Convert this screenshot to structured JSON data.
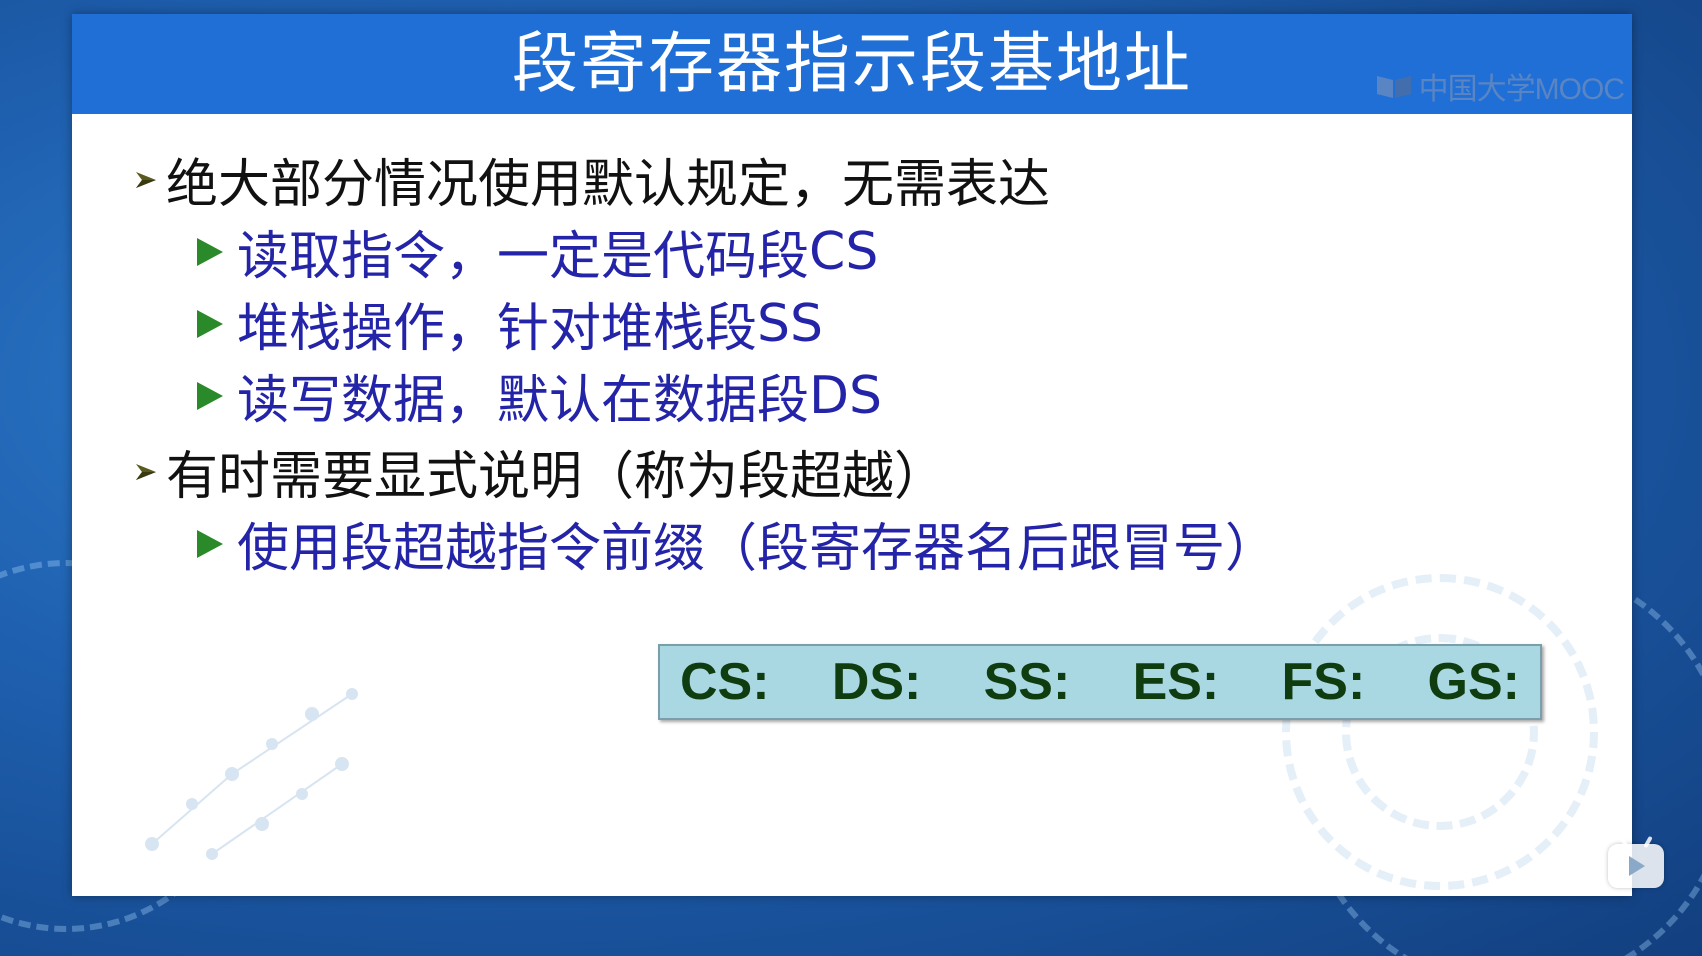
{
  "slide": {
    "title": "段寄存器指示段基地址",
    "logo_text": "中国大学MOOC"
  },
  "bullets": [
    {
      "level": 1,
      "text": "绝大部分情况使用默认规定，无需表达",
      "children": [
        {
          "level": 2,
          "text": "读取指令，一定是代码段",
          "register": "CS"
        },
        {
          "level": 2,
          "text": "堆栈操作，针对堆栈段",
          "register": "SS"
        },
        {
          "level": 2,
          "text": "读写数据，默认在数据段",
          "register": "DS"
        }
      ]
    },
    {
      "level": 1,
      "text": "有时需要显式说明（称为段超越）",
      "children": [
        {
          "level": 2,
          "text": "使用段超越指令前缀（段寄存器名后跟冒号）"
        }
      ]
    }
  ],
  "segment_prefixes": [
    "CS:",
    "DS:",
    "SS:",
    "ES:",
    "FS:",
    "GS:"
  ],
  "colors": {
    "title_bar": "#1f6fd6",
    "level1_text": "#111111",
    "level2_text": "#2424a8",
    "level2_bullet": "#2a8a2a",
    "prefix_box": "#a9d8e3",
    "prefix_text": "#0f3d0f"
  },
  "icons": {
    "level1_bullet": "chevron-arrow-icon",
    "level2_bullet": "triangle-right-icon",
    "logo": "mooc-book-icon",
    "player_badge": "play-icon"
  }
}
